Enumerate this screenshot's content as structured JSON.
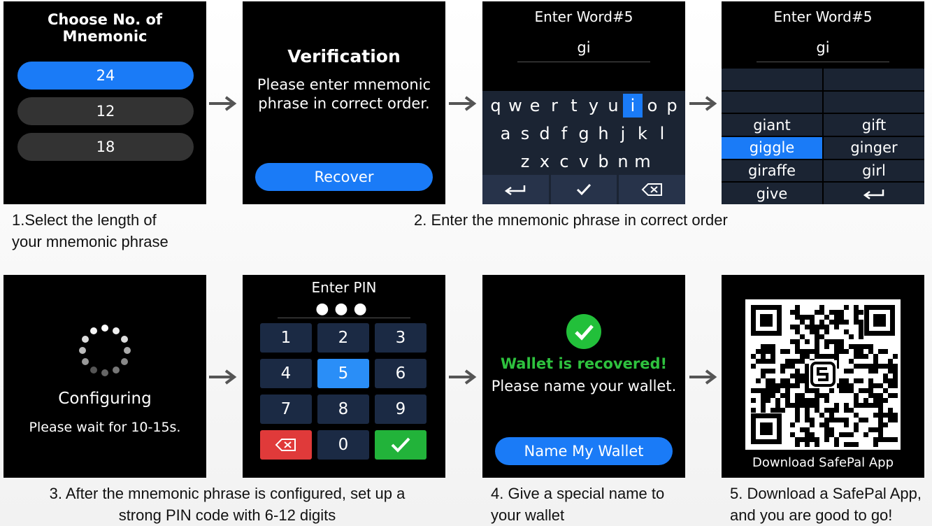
{
  "step1": {
    "title": "Choose No. of Mnemonic",
    "options": [
      "24",
      "12",
      "18"
    ],
    "caption_line1": "1.Select the length of",
    "caption_line2": "your mnemonic phrase"
  },
  "step2": {
    "title": "Verification",
    "message_line1": "Please enter mnemonic",
    "message_line2": "phrase in correct order.",
    "button": "Recover",
    "caption": "2. Enter the mnemonic phrase in correct order"
  },
  "keyboard": {
    "title": "Enter Word#5",
    "typed": "gi",
    "row1": [
      "q",
      "w",
      "e",
      "r",
      "t",
      "y",
      "u",
      "i",
      "o",
      "p"
    ],
    "row2": [
      "a",
      "s",
      "d",
      "f",
      "g",
      "h",
      "j",
      "k",
      "l"
    ],
    "row3": [
      "z",
      "x",
      "c",
      "v",
      "b",
      "n",
      "m"
    ],
    "highlight": "i"
  },
  "suggest": {
    "title": "Enter Word#5",
    "typed": "gi",
    "words": [
      "giant",
      "gift",
      "giggle",
      "ginger",
      "giraffe",
      "girl",
      "give"
    ],
    "selected": "giggle"
  },
  "step3": {
    "title": "Configuring",
    "subtitle": "Please wait for 10-15s.",
    "pin_title": "Enter PIN",
    "pin_dots": "●●●",
    "keys": [
      "1",
      "2",
      "3",
      "4",
      "5",
      "6",
      "7",
      "8",
      "9",
      "0"
    ],
    "caption_line1": "3. After the mnemonic phrase is configured, set up a",
    "caption_line2": "strong PIN code with 6-12 digits"
  },
  "step4": {
    "success": "Wallet is recovered!",
    "prompt": "Please name your wallet.",
    "button": "Name My Wallet",
    "caption_line1": "4. Give a special name to",
    "caption_line2": "your wallet"
  },
  "step5": {
    "label": "Download SafePal App",
    "caption_line1": "5. Download a SafePal App,",
    "caption_line2": "and you are good to go!"
  },
  "colors": {
    "accent": "#1a7bf7",
    "success": "#22c03a",
    "danger": "#e03a3a",
    "key": "#1b2433"
  }
}
